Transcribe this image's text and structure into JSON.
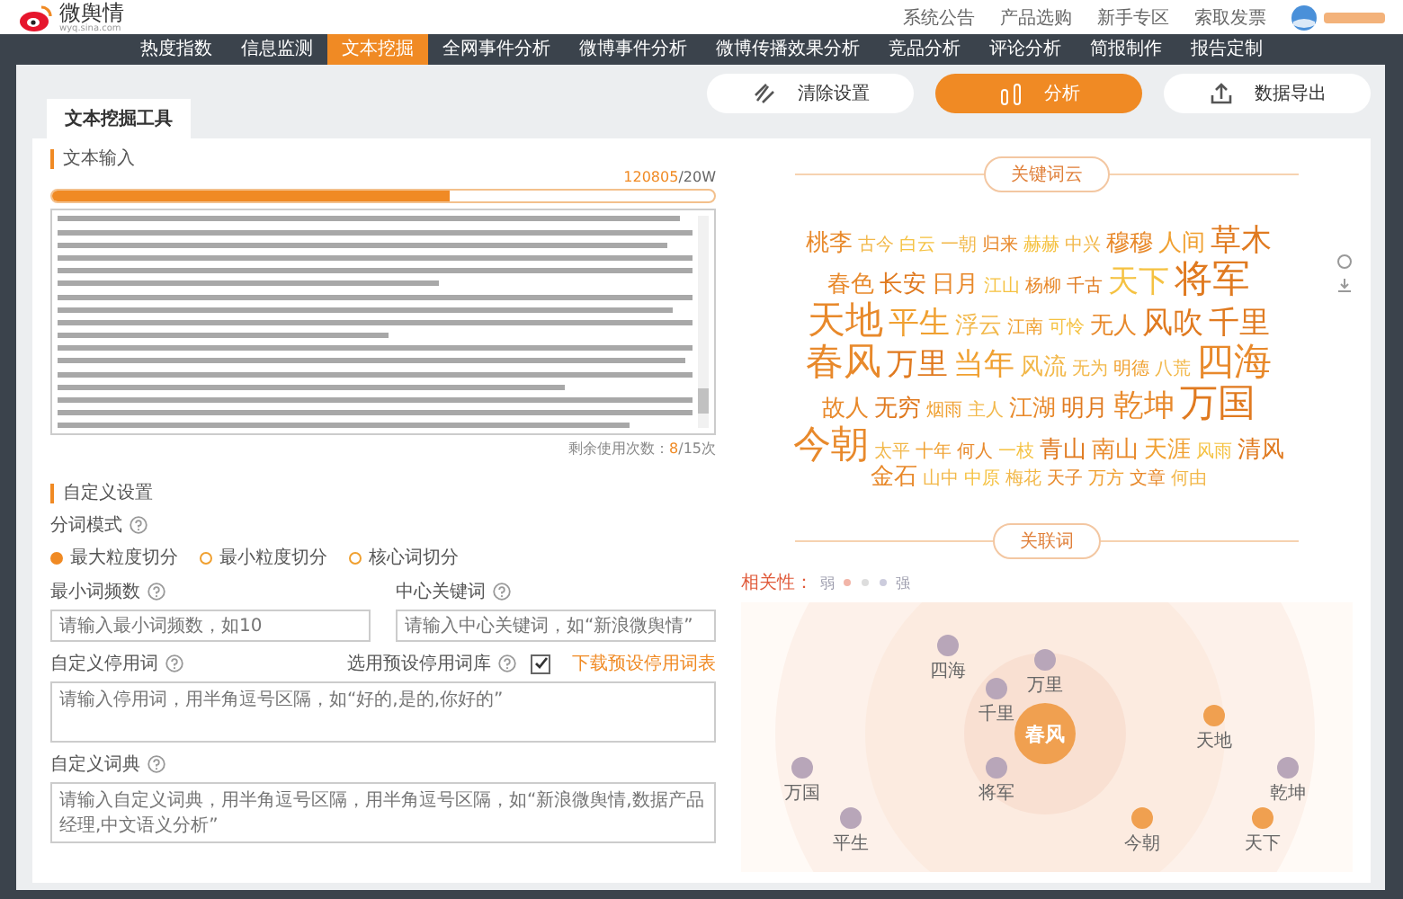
{
  "header": {
    "logo_text": "微舆情",
    "logo_domain": "wyq.sina.com",
    "links": [
      "系统公告",
      "产品选购",
      "新手专区",
      "索取发票"
    ]
  },
  "nav": [
    {
      "label": "热度指数",
      "selected": false
    },
    {
      "label": "信息监测",
      "selected": false
    },
    {
      "label": "文本挖掘",
      "selected": true
    },
    {
      "label": "全网事件分析",
      "selected": false
    },
    {
      "label": "微博事件分析",
      "selected": false
    },
    {
      "label": "微博传播效果分析",
      "selected": false
    },
    {
      "label": "竞品分析",
      "selected": false
    },
    {
      "label": "评论分析",
      "selected": false
    },
    {
      "label": "简报制作",
      "selected": false
    },
    {
      "label": "报告定制",
      "selected": false
    }
  ],
  "toolbar": [
    {
      "label": "清除设置",
      "kind": "clear"
    },
    {
      "label": "分析",
      "kind": "primary"
    },
    {
      "label": "数据导出",
      "kind": "export"
    }
  ],
  "tab": "文本挖掘工具",
  "text_input": {
    "title": "文本输入",
    "count": "120805",
    "limit": "/20W",
    "level": 0.6,
    "remaining_label": "剩余使用次数：",
    "remaining_count": "8",
    "remaining_total": "/15次"
  },
  "settings": {
    "title": "自定义设置",
    "mode_label": "分词模式",
    "modes": [
      {
        "label": "最大粒度切分",
        "selected": true
      },
      {
        "label": "最小粒度切分",
        "selected": false
      },
      {
        "label": "核心词切分",
        "selected": false
      }
    ],
    "min_freq": {
      "label": "最小词频数",
      "placeholder": "请输入最小词频数，如10"
    },
    "center_kw": {
      "label": "中心关键词",
      "placeholder": "请输入中心关键词，如“新浪微舆情”"
    },
    "stopwords": {
      "label": "自定义停用词",
      "preset_label": "选用预设停用词库",
      "preset_checked": true,
      "download_link": "下载预设停用词表",
      "placeholder": "请输入停用词，用半角逗号区隔，如“好的,是的,你好的”"
    },
    "dictionary": {
      "label": "自定义词典",
      "placeholder": "请输入自定义词典，用半角逗号区隔，用半角逗号区隔，如“新浪微舆情,数据产品经理,中文语义分析”"
    }
  },
  "wordcloud": {
    "title": "关键词云",
    "words": [
      {
        "text": "桃李",
        "kind": "m",
        "color": "#e8892b"
      },
      {
        "text": "古今",
        "kind": "s",
        "color": "#f2b84a"
      },
      {
        "text": "白云",
        "kind": "s",
        "color": "#f5c242"
      },
      {
        "text": "一朝",
        "kind": "s",
        "color": "#f2b84a"
      },
      {
        "text": "归来",
        "kind": "s",
        "color": "#e8892b"
      },
      {
        "text": "赫赫",
        "kind": "s",
        "color": "#f5c242"
      },
      {
        "text": "中兴",
        "kind": "s",
        "color": "#f2b84a"
      },
      {
        "text": "穆穆",
        "kind": "m",
        "color": "#e8892b"
      },
      {
        "text": "人间",
        "kind": "m",
        "color": "#f0a030"
      },
      {
        "text": "草木",
        "kind": "l",
        "color": "#e07a20"
      },
      {
        "text": "春色",
        "kind": "m",
        "color": "#e8892b"
      },
      {
        "text": "长安",
        "kind": "m",
        "color": "#e07a20"
      },
      {
        "text": "日月",
        "kind": "m",
        "color": "#e8892b"
      },
      {
        "text": "江山",
        "kind": "s",
        "color": "#f5c242"
      },
      {
        "text": "杨柳",
        "kind": "s",
        "color": "#e8892b"
      },
      {
        "text": "千古",
        "kind": "s",
        "color": "#e07a20"
      },
      {
        "text": "天下",
        "kind": "l",
        "color": "#f5c242"
      },
      {
        "text": "将军",
        "kind": "xl",
        "color": "#e07a20"
      },
      {
        "text": "天地",
        "kind": "xl",
        "color": "#e8892b"
      },
      {
        "text": "平生",
        "kind": "l",
        "color": "#f0a030"
      },
      {
        "text": "浮云",
        "kind": "m",
        "color": "#f2b84a"
      },
      {
        "text": "江南",
        "kind": "s",
        "color": "#f0a030"
      },
      {
        "text": "可怜",
        "kind": "s",
        "color": "#f5c242"
      },
      {
        "text": "无人",
        "kind": "m",
        "color": "#e8892b"
      },
      {
        "text": "风吹",
        "kind": "l",
        "color": "#e07a20"
      },
      {
        "text": "千里",
        "kind": "l",
        "color": "#e07a20"
      },
      {
        "text": "春风",
        "kind": "xl",
        "color": "#e8892b"
      },
      {
        "text": "万里",
        "kind": "l",
        "color": "#e07a20"
      },
      {
        "text": "当年",
        "kind": "l",
        "color": "#f0a030"
      },
      {
        "text": "风流",
        "kind": "m",
        "color": "#f2b84a"
      },
      {
        "text": "无为",
        "kind": "s",
        "color": "#f2b84a"
      },
      {
        "text": "明德",
        "kind": "s",
        "color": "#f0a030"
      },
      {
        "text": "八荒",
        "kind": "s",
        "color": "#f2b84a"
      },
      {
        "text": "四海",
        "kind": "xl",
        "color": "#e8892b"
      },
      {
        "text": "故人",
        "kind": "m",
        "color": "#e8892b"
      },
      {
        "text": "无穷",
        "kind": "m",
        "color": "#e07a20"
      },
      {
        "text": "烟雨",
        "kind": "s",
        "color": "#f0a030"
      },
      {
        "text": "主人",
        "kind": "s",
        "color": "#f2b84a"
      },
      {
        "text": "江湖",
        "kind": "m",
        "color": "#e8892b"
      },
      {
        "text": "明月",
        "kind": "m",
        "color": "#e07a20"
      },
      {
        "text": "乾坤",
        "kind": "l",
        "color": "#e8892b"
      },
      {
        "text": "万国",
        "kind": "xl",
        "color": "#e07a20"
      },
      {
        "text": "今朝",
        "kind": "xl",
        "color": "#e8892b"
      },
      {
        "text": "太平",
        "kind": "s",
        "color": "#f2b84a"
      },
      {
        "text": "十年",
        "kind": "s",
        "color": "#f0a030"
      },
      {
        "text": "何人",
        "kind": "s",
        "color": "#e8892b"
      },
      {
        "text": "一枝",
        "kind": "s",
        "color": "#f5c242"
      },
      {
        "text": "青山",
        "kind": "m",
        "color": "#e07a20"
      },
      {
        "text": "南山",
        "kind": "m",
        "color": "#e8892b"
      },
      {
        "text": "天涯",
        "kind": "m",
        "color": "#f0a030"
      },
      {
        "text": "风雨",
        "kind": "s",
        "color": "#f5c242"
      },
      {
        "text": "清风",
        "kind": "m",
        "color": "#e07a20"
      },
      {
        "text": "金石",
        "kind": "m",
        "color": "#e8892b"
      },
      {
        "text": "山中",
        "kind": "s",
        "color": "#f2b84a"
      },
      {
        "text": "中原",
        "kind": "s",
        "color": "#f5c242"
      },
      {
        "text": "梅花",
        "kind": "s",
        "color": "#f2b84a"
      },
      {
        "text": "天子",
        "kind": "s",
        "color": "#e8892b"
      },
      {
        "text": "万方",
        "kind": "s",
        "color": "#f0a030"
      },
      {
        "text": "文章",
        "kind": "s",
        "color": "#e8892b"
      },
      {
        "text": "何由",
        "kind": "s",
        "color": "#f2b84a"
      }
    ]
  },
  "related": {
    "title": "关联词",
    "legend": {
      "label": "相关性：",
      "weak": "弱",
      "strong": "强"
    },
    "center": "春风",
    "nodes": [
      {
        "label": "四海",
        "color": "#b8a6b9"
      },
      {
        "label": "万里",
        "color": "#b8a6b9"
      },
      {
        "label": "千里",
        "color": "#b8a6b9"
      },
      {
        "label": "天地",
        "color": "#f0a050"
      },
      {
        "label": "万国",
        "color": "#b8a6b9"
      },
      {
        "label": "将军",
        "color": "#b8a6b9"
      },
      {
        "label": "乾坤",
        "color": "#b8a6b9"
      },
      {
        "label": "平生",
        "color": "#b8a6b9"
      },
      {
        "label": "今朝",
        "color": "#f0a050"
      },
      {
        "label": "天下",
        "color": "#f0a050"
      }
    ]
  }
}
